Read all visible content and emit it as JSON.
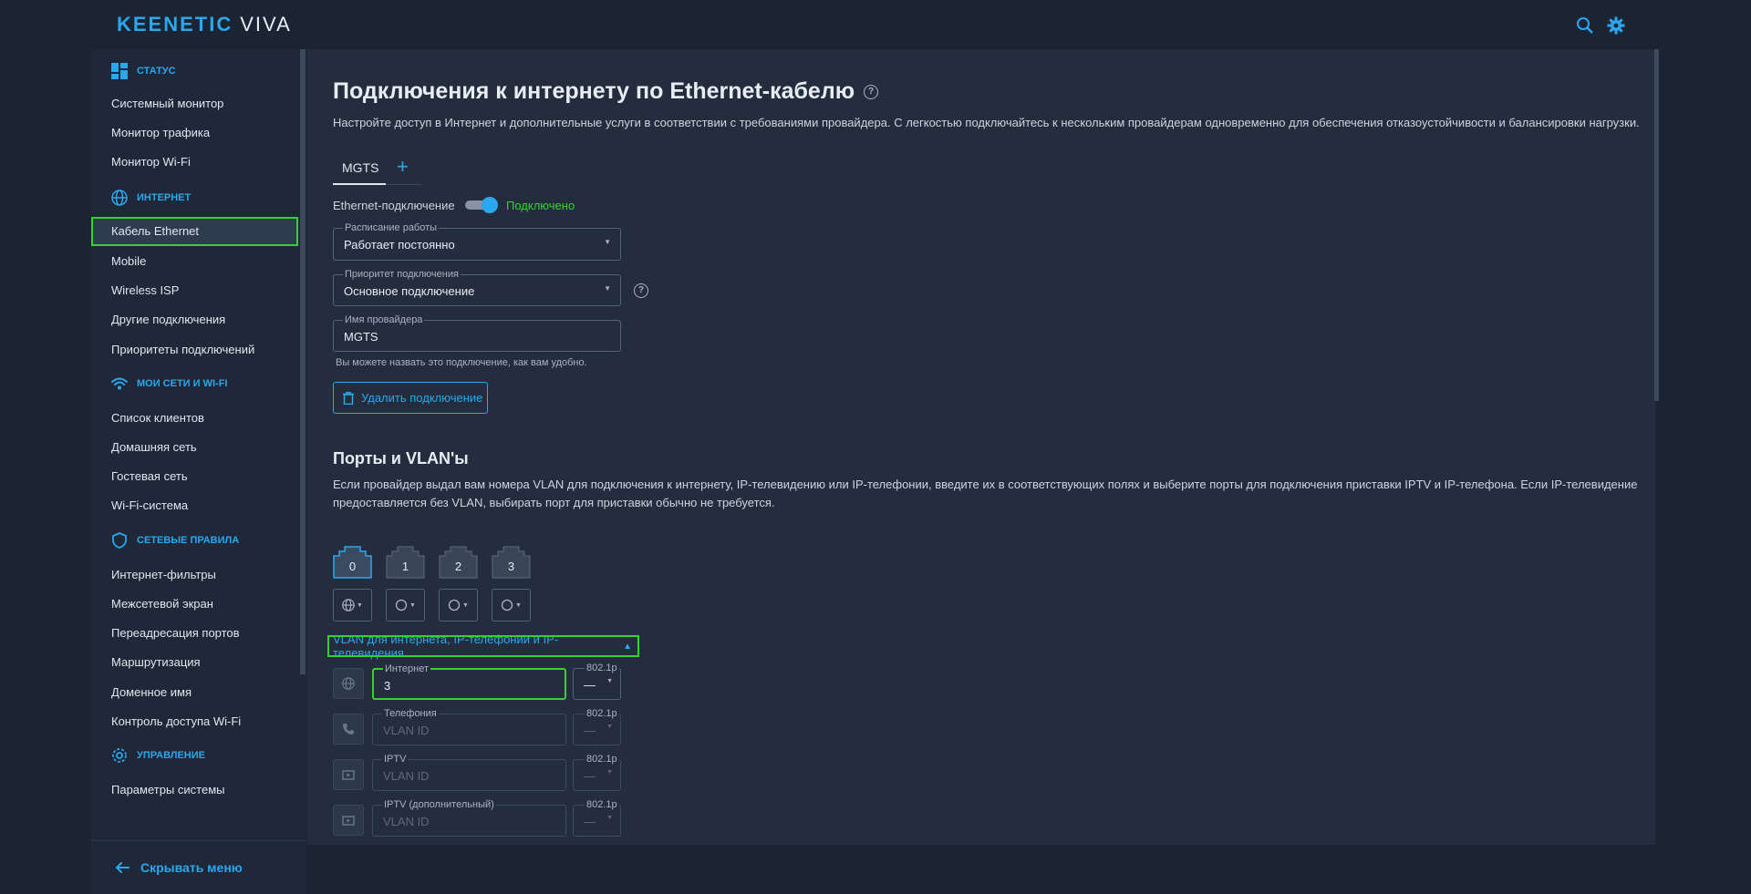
{
  "header": {
    "brand": "KEENETIC",
    "model": "VIVA"
  },
  "sidebar": {
    "sections": [
      {
        "title": "Статус",
        "icon": "dashboard-icon"
      },
      {
        "title": "Интернет",
        "icon": "globe-icon"
      },
      {
        "title": "Мои сети и Wi-Fi",
        "icon": "wifi-icon"
      },
      {
        "title": "Сетевые правила",
        "icon": "shield-icon"
      },
      {
        "title": "Управление",
        "icon": "gear-icon"
      }
    ],
    "items": [
      "Системный монитор",
      "Монитор трафика",
      "Монитор Wi-Fi",
      "Кабель Ethernet",
      "Mobile",
      "Wireless ISP",
      "Другие подключения",
      "Приоритеты подключений",
      "Список клиентов",
      "Домашняя сеть",
      "Гостевая сеть",
      "Wi-Fi-система",
      "Интернет-фильтры",
      "Межсетевой экран",
      "Переадресация портов",
      "Маршрутизация",
      "Доменное имя",
      "Контроль доступа Wi-Fi",
      "Параметры системы"
    ],
    "active_item": "Кабель Ethernet",
    "hide_menu": "Скрывать меню"
  },
  "page": {
    "title": "Подключения к интернету по Ethernet-кабелю",
    "description": "Настройте доступ в Интернет и дополнительные услуги в соответствии с требованиями провайдера. С легкостью подключайтесь к нескольким провайдерам одновременно для обеспечения отказоустойчивости и балансировки нагрузки.",
    "tab": "MGTS",
    "ethernet_label": "Ethernet-подключение",
    "ethernet_status": "Подключено",
    "ethernet_enabled": true,
    "schedule": {
      "label": "Расписание работы",
      "value": "Работает постоянно"
    },
    "priority": {
      "label": "Приоритет подключения",
      "value": "Основное подключение"
    },
    "provider": {
      "label": "Имя провайдера",
      "value": "MGTS"
    },
    "provider_hint": "Вы можете назвать это подключение, как вам удобно.",
    "delete_button": "Удалить подключение",
    "ports_title": "Порты и VLAN'ы",
    "ports_description_1": "Если провайдер выдал вам номера VLAN для подключения к интернету, IP-телевидению или IP-телефонии, введите их в соответствующих полях и выберите порты для подключения приставки IPTV и IP-телефона. Если IP-телевидение",
    "ports_description_2": "предоставляется без VLAN, выбирать порт для приставки обычно не требуется.",
    "ports": [
      "0",
      "1",
      "2",
      "3"
    ],
    "selected_port": "0",
    "vlan_section": "VLAN для интернета, IP-телефонии и IP-телевидения",
    "vlans": [
      {
        "label": "Интернет",
        "value": "3",
        "placeholder": "VLAN ID",
        "prio_label": "802.1p",
        "prio_value": "—",
        "icon": "globe-icon"
      },
      {
        "label": "Телефония",
        "value": "",
        "placeholder": "VLAN ID",
        "prio_label": "802.1p",
        "prio_value": "—",
        "icon": "phone-icon"
      },
      {
        "label": "IPTV",
        "value": "",
        "placeholder": "VLAN ID",
        "prio_label": "802.1p",
        "prio_value": "—",
        "icon": "tv-icon"
      },
      {
        "label": "IPTV (дополнительный)",
        "value": "",
        "placeholder": "VLAN ID",
        "prio_label": "802.1p",
        "prio_value": "—",
        "icon": "tv-icon"
      }
    ]
  },
  "colors": {
    "accent": "#2aa7ef",
    "success": "#35d22d",
    "background": "#232d3e",
    "sidebar": "#1e2838"
  }
}
